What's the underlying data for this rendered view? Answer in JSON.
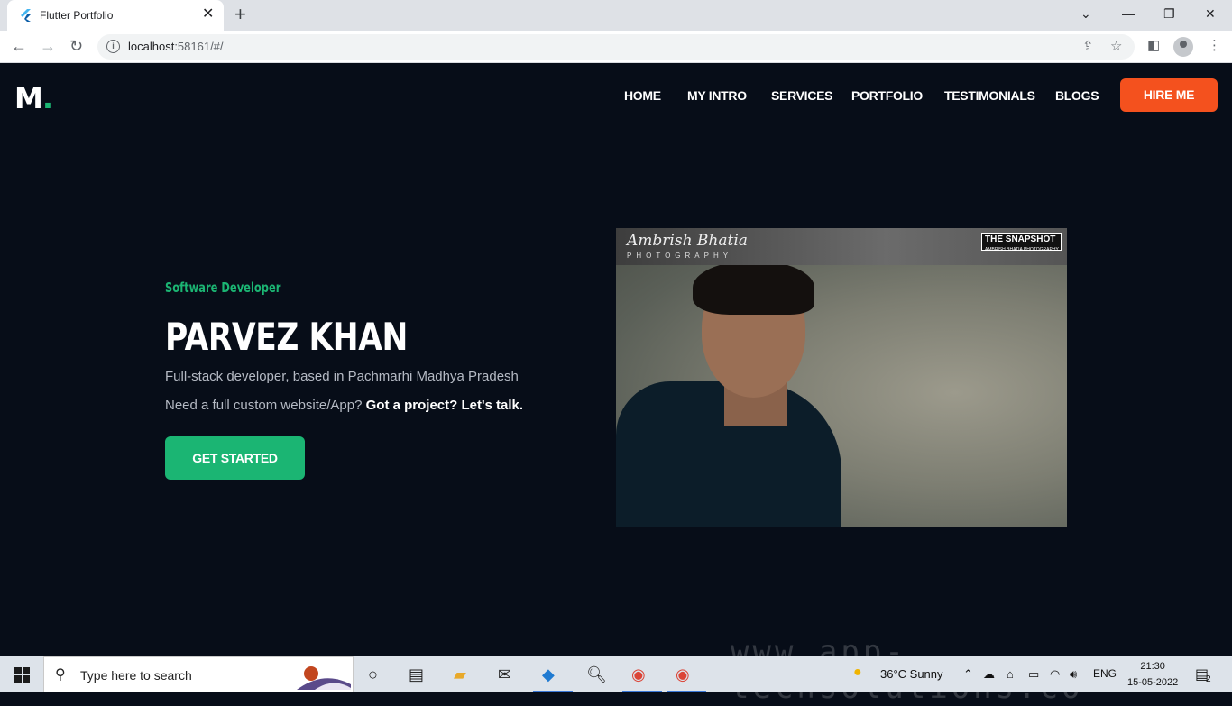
{
  "browser": {
    "tab_title": "Flutter Portfolio",
    "tab_close": "✕",
    "new_tab": "+",
    "url_host": "localhost",
    "url_rest": ":58161/#/",
    "window_controls": [
      "⌄",
      "—",
      "❐",
      "✕"
    ]
  },
  "site": {
    "logo": "M",
    "logo_dot": ".",
    "nav": [
      "HOME",
      "MY INTRO",
      "SERVICES",
      "PORTFOLIO",
      "TESTIMONIALS",
      "BLOGS"
    ],
    "hire_label": "HIRE ME"
  },
  "hero": {
    "role": "Software Developer",
    "name": "PARVEZ KHAN",
    "description": "Full-stack developer, based in Pachmarhi Madhya Pradesh",
    "cta_text": "Need a full custom website/App? ",
    "cta_strong": "Got a project? Let's talk.",
    "button_label": "GET STARTED",
    "photo_signature": "Ambrish Bhatia",
    "photo_signature_sub": "PHOTOGRAPHY",
    "photo_badge": "THE SNAPSHOT",
    "photo_badge_sub": "AMBRISH BHATIA PHOTOGRAPHY"
  },
  "taskbar": {
    "search_placeholder": "Type here to search",
    "weather": "36°C  Sunny",
    "language": "ENG",
    "time": "21:30",
    "date": "15-05-2022",
    "notifications": "2"
  },
  "watermark": "www.app-techsolutions.co",
  "colors": {
    "page_bg": "#070d18",
    "accent_green": "#1bb573",
    "accent_orange": "#f4511e"
  }
}
